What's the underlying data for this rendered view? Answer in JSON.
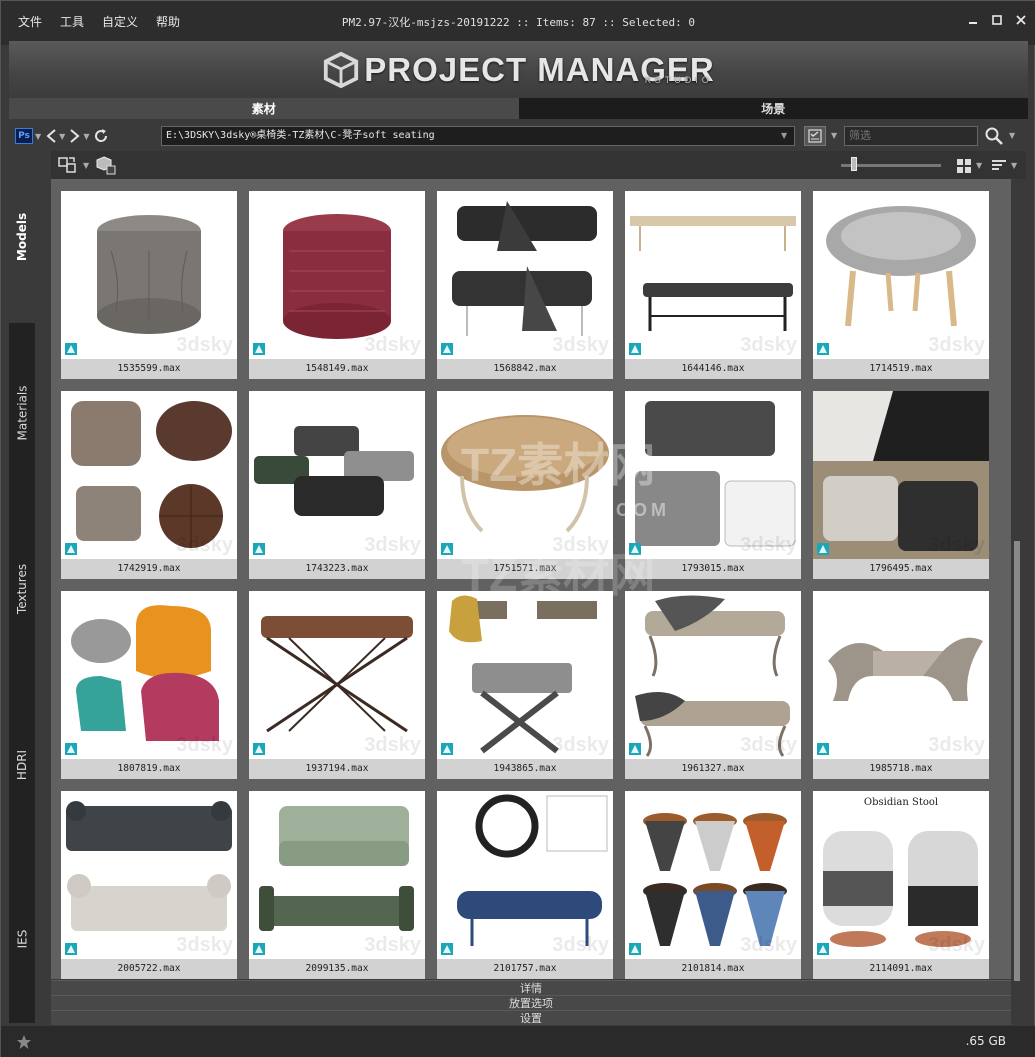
{
  "menu": [
    "文件",
    "工具",
    "自定义",
    "帮助"
  ],
  "window_title": "PM2.97-汉化-msjzs-20191222  :: Items: 87  :: Selected: 0",
  "logo": {
    "main": "PROJECT MANAGER",
    "sub": "KSTUDIO"
  },
  "tabs": [
    {
      "label": "素材",
      "active": true
    },
    {
      "label": "场景",
      "active": false
    }
  ],
  "toolbar": {
    "ps_label": "Ps",
    "path": "E:\\3DSKY\\3dsky®桌椅类-TZ素材\\C-凳子soft seating",
    "filter_placeholder": "筛选"
  },
  "side_tabs": [
    {
      "label": "Models",
      "active": true
    },
    {
      "label": "Materials",
      "active": false
    },
    {
      "label": "Textures",
      "active": false
    },
    {
      "label": "HDRI",
      "active": false
    },
    {
      "label": "IES",
      "active": false
    }
  ],
  "items": [
    {
      "file": "1535599.max",
      "kind": "pouf-gray"
    },
    {
      "file": "1548149.max",
      "kind": "pouf-red"
    },
    {
      "file": "1568842.max",
      "kind": "bench-black"
    },
    {
      "file": "1644146.max",
      "kind": "bench-beige"
    },
    {
      "file": "1714519.max",
      "kind": "fur-stool"
    },
    {
      "file": "1742919.max",
      "kind": "brown-poufs"
    },
    {
      "file": "1743223.max",
      "kind": "dark-poufs"
    },
    {
      "file": "1751571.max",
      "kind": "oval-bench"
    },
    {
      "file": "1793015.max",
      "kind": "gray-covered"
    },
    {
      "file": "1796495.max",
      "kind": "knit-cubes"
    },
    {
      "file": "1807819.max",
      "kind": "color-chairs"
    },
    {
      "file": "1937194.max",
      "kind": "x-bench-brown"
    },
    {
      "file": "1943865.max",
      "kind": "x-stools"
    },
    {
      "file": "1961327.max",
      "kind": "carved-bench"
    },
    {
      "file": "1985718.max",
      "kind": "curved-bench"
    },
    {
      "file": "2005722.max",
      "kind": "daybed-dark"
    },
    {
      "file": "2099135.max",
      "kind": "sofa-green"
    },
    {
      "file": "2101757.max",
      "kind": "blue-bench"
    },
    {
      "file": "2101814.max",
      "kind": "cone-stools"
    },
    {
      "file": "2114091.max",
      "kind": "obsidian",
      "label": "Obsidian Stool"
    }
  ],
  "thumb_watermark": "3dsky",
  "overlay_watermark": {
    "cn": "TZ素材网",
    "en": "TZSUCAI.COM"
  },
  "expanders": [
    "详情",
    "放置选项",
    "设置"
  ],
  "status": {
    "disk_size": ".65 GB"
  },
  "colors": {
    "ps_blue": "#3d7bd6",
    "max_teal": "#1aa7b8",
    "bg_panel": "#616161"
  }
}
